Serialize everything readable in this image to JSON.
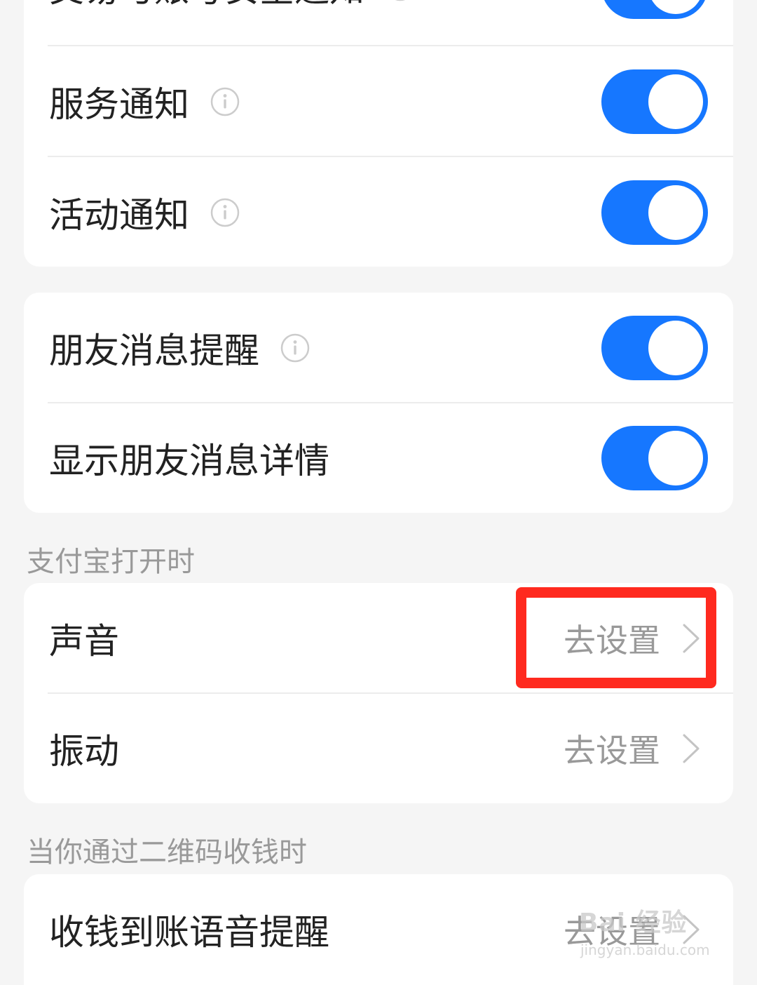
{
  "card1": {
    "rows": [
      {
        "label": "交易与账号安全通知",
        "toggle_on": true
      },
      {
        "label": "服务通知",
        "toggle_on": true
      },
      {
        "label": "活动通知",
        "toggle_on": true
      }
    ]
  },
  "card2": {
    "rows": [
      {
        "label": "朋友消息提醒",
        "toggle_on": true
      },
      {
        "label": "显示朋友消息详情",
        "toggle_on": true
      }
    ]
  },
  "section_app_open": {
    "header": "支付宝打开时",
    "rows": [
      {
        "label": "声音",
        "action": "去设置"
      },
      {
        "label": "振动",
        "action": "去设置"
      }
    ]
  },
  "section_qr": {
    "header": "当你通过二维码收钱时",
    "rows": [
      {
        "label": "收钱到账语音提醒",
        "action": "去设置"
      }
    ]
  },
  "colors": {
    "toggle_on": "#1677ff",
    "highlight": "#ff2a1f",
    "background": "#f5f5f5"
  },
  "watermark": {
    "brand": "Bai 经验",
    "url": "jingyan.baidu.com"
  }
}
